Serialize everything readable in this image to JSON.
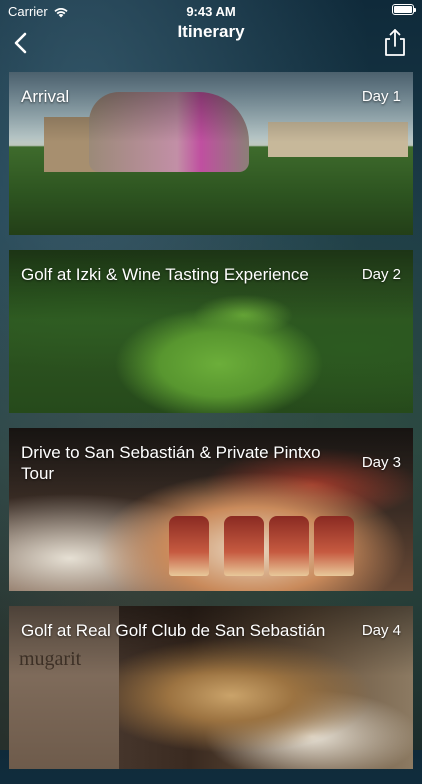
{
  "status_bar": {
    "carrier": "Carrier",
    "time": "9:43 AM",
    "battery": 1.0
  },
  "nav": {
    "title": "Itinerary"
  },
  "icons": {
    "back": "chevron-left-icon",
    "share": "share-icon",
    "wifi": "wifi-icon",
    "battery": "battery-icon"
  },
  "itinerary": [
    {
      "title": "Arrival",
      "day": "Day 1"
    },
    {
      "title": "Golf at Izki & Wine Tasting Experience",
      "day": "Day 2"
    },
    {
      "title": "Drive to San Sebastián & Private Pintxo Tour",
      "day": "Day 3"
    },
    {
      "title": "Golf at Real Golf Club de San Sebastián",
      "day": "Day 4"
    }
  ],
  "photo_text": {
    "restaurant_sign": "mugarit"
  }
}
